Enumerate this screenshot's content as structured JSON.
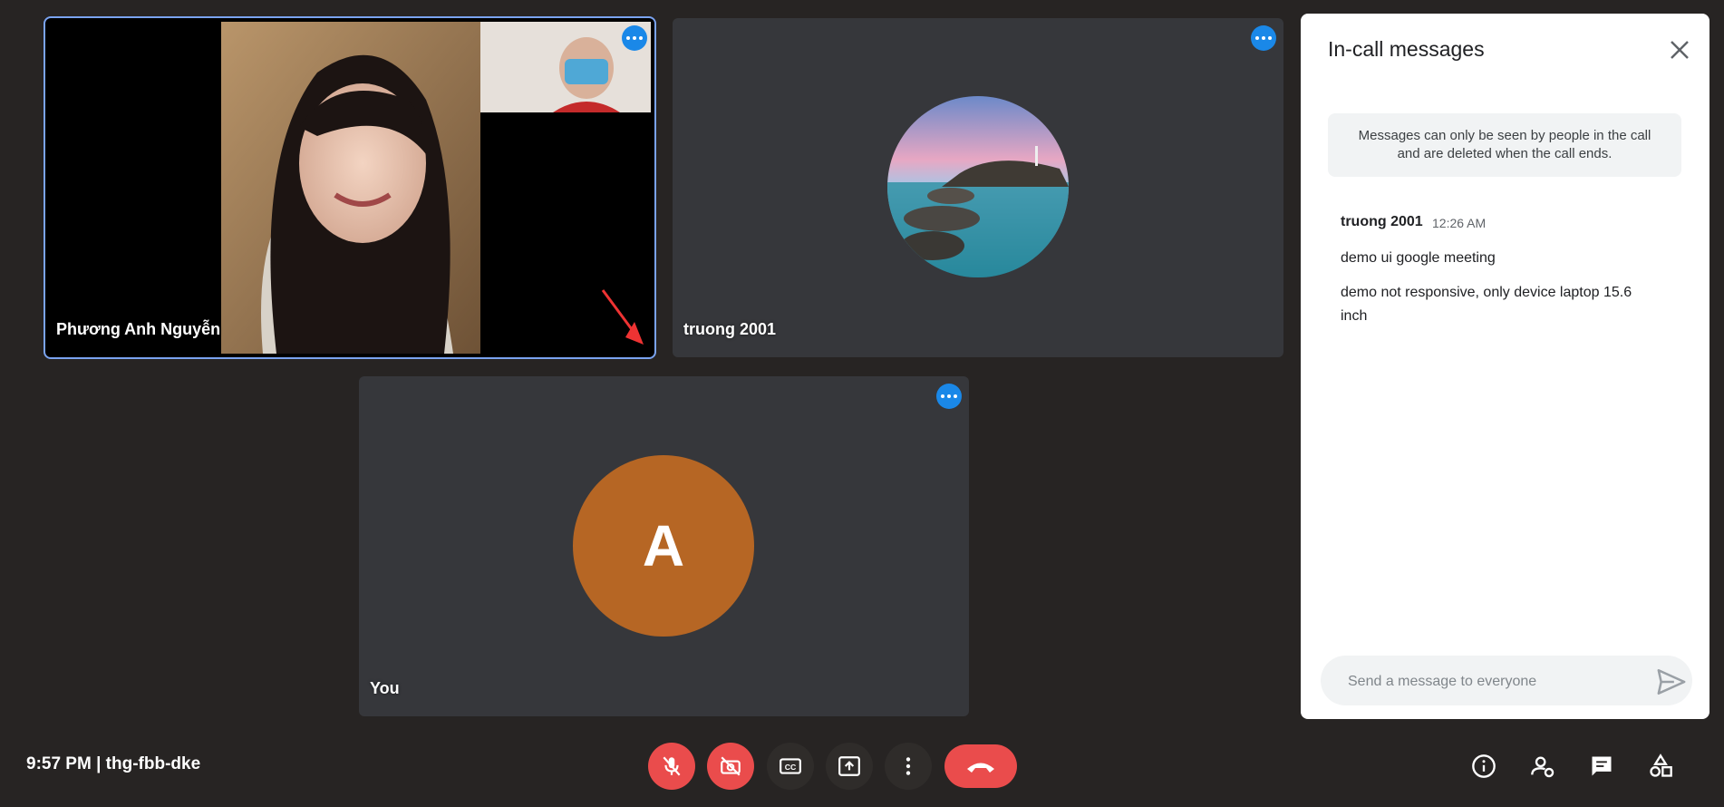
{
  "tiles": [
    {
      "name": "Phương Anh Nguyễn"
    },
    {
      "name": "truong 2001"
    },
    {
      "name": "You",
      "avatar_letter": "A"
    }
  ],
  "chat": {
    "title": "In-call messages",
    "notice": "Messages can only be seen by people in the call and are deleted when the call ends.",
    "messages": [
      {
        "sender": "truong 2001",
        "time": "12:26 AM",
        "texts": [
          "demo ui google meeting",
          "demo not responsive, only device laptop 15.6 inch"
        ]
      }
    ],
    "input_placeholder": "Send a message to everyone"
  },
  "meeting_info": "9:57 PM | thg-fbb-dke",
  "colors": {
    "background": "#272423",
    "tile": "#36373b",
    "accent_blue": "#1a88e8",
    "active_outline": "#7aa3f0",
    "red": "#ea4c4c",
    "avatar_orange": "#b66624"
  }
}
